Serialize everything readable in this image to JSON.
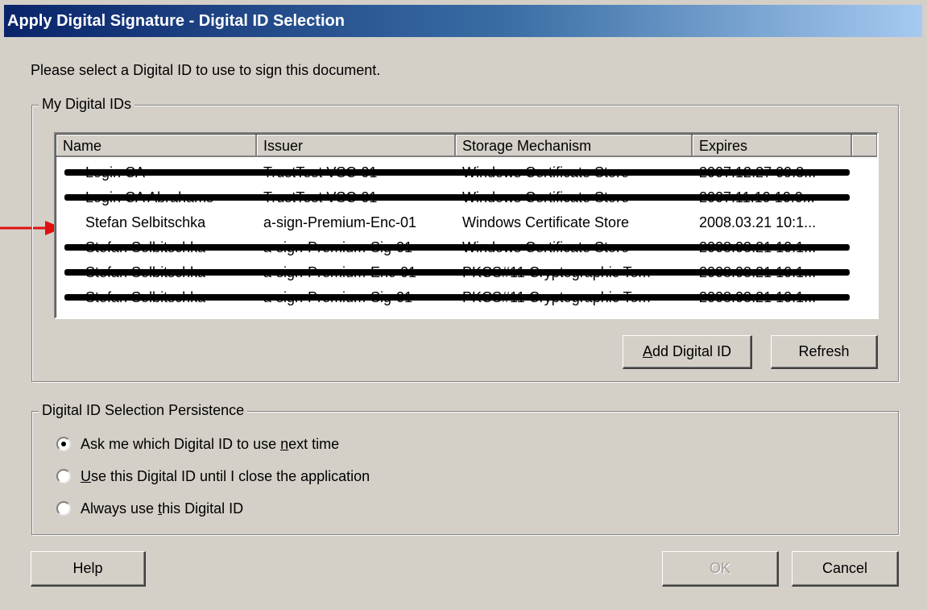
{
  "window": {
    "title": "Apply Digital Signature - Digital ID Selection"
  },
  "prompt": "Please select a Digital ID to use to sign this document.",
  "ids_group": {
    "label": "My Digital IDs",
    "columns": [
      "Name",
      "Issuer",
      "Storage Mechanism",
      "Expires"
    ],
    "rows": [
      {
        "name": "Login CA",
        "issuer": "TrustTest VSC-01",
        "storage": "Windows Certificate Store",
        "expires": "2007.12.27 09:3...",
        "redacted": true
      },
      {
        "name": "Login CA Abrahams",
        "issuer": "TrustTest VSC-01",
        "storage": "Windows Certificate Store",
        "expires": "2007.11.19 10:0...",
        "redacted": true
      },
      {
        "name": "Stefan Selbitschka",
        "issuer": "a-sign-Premium-Enc-01",
        "storage": "Windows Certificate Store",
        "expires": "2008.03.21 10:1...",
        "redacted": false
      },
      {
        "name": "Stefan Selbitschka",
        "issuer": "a-sign-Premium-Sig-01",
        "storage": "Windows Certificate Store",
        "expires": "2008.03.21 10:1...",
        "redacted": true
      },
      {
        "name": "Stefan Selbitschka",
        "issuer": "a-sign-Premium-Enc-01",
        "storage": "PKCS#11 Cryptographic Tom",
        "expires": "2008.03.21 10:1...",
        "redacted": true
      },
      {
        "name": "Stefan Selbitschka",
        "issuer": "a-sign-Premium-Sig-01",
        "storage": "PKCS#11 Cryptographic Tom",
        "expires": "2008.03.21 10:1...",
        "redacted": true
      }
    ],
    "add_button": {
      "accel": "A",
      "rest": "dd Digital ID"
    },
    "refresh_button": "Refresh"
  },
  "persist_group": {
    "label": "Digital ID Selection Persistence",
    "options": [
      {
        "before": "Ask me which Digital ID to use ",
        "accel": "n",
        "after": "ext time",
        "checked": true
      },
      {
        "before": "",
        "accel": "U",
        "after": "se this Digital ID until I close the application",
        "checked": false
      },
      {
        "before": "Always use ",
        "accel": "t",
        "after": "his Digital ID",
        "checked": false
      }
    ]
  },
  "footer": {
    "help": "Help",
    "ok": "OK",
    "cancel": "Cancel"
  },
  "colors": {
    "titlebar_start": "#0a246a",
    "face": "#d4d0c8",
    "arrow": "#ff0000"
  }
}
